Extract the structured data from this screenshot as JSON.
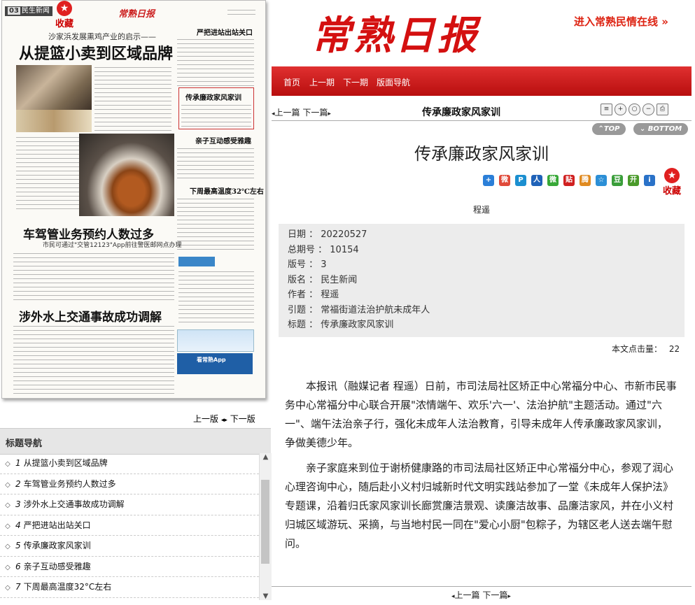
{
  "newspaper_page": {
    "section_tag_num": "03",
    "section_tag_name": "民生新闻",
    "favorite_label": "收藏",
    "paper_logo": "常熟日报",
    "kicker": "沙家浜发展熏鸡产业的启示——",
    "headline1": "从提篮小卖到区域品牌",
    "headline2": "车驾管业务预约人数过多",
    "headline2_sub": "市民可通过\"交管12123\"App前往警医邮网点办理",
    "headline3": "涉外水上交通事故成功调解",
    "col_head1": "严把进站出站关口",
    "col_head2": "传承廉政家风家训",
    "col_head3": "亲子互动感受雅趣",
    "col_head4": "下周最高温度32℃左右",
    "ad_text": "看常熟App"
  },
  "page_nav": {
    "prev": "上一版",
    "next": "下一版"
  },
  "title_nav": {
    "heading": "标题导航",
    "items": [
      {
        "num": "1",
        "label": "从提篮小卖到区域品牌"
      },
      {
        "num": "2",
        "label": "车驾管业务预约人数过多"
      },
      {
        "num": "3",
        "label": "涉外水上交通事故成功调解"
      },
      {
        "num": "4",
        "label": "严把进站出站关口"
      },
      {
        "num": "5",
        "label": "传承廉政家风家训"
      },
      {
        "num": "6",
        "label": "亲子互动感受雅趣"
      },
      {
        "num": "7",
        "label": "下周最高温度32°C左右"
      }
    ]
  },
  "masthead": {
    "logo": "常熟日报",
    "enter_link": "进入常熟民情在线"
  },
  "menu": [
    "首页",
    "上一期",
    "下一期",
    "版面导航"
  ],
  "toolbar": {
    "prev": "上一篇",
    "next": "下一篇",
    "title": "传承廉政家风家训",
    "top": "TOP",
    "bottom": "BOTTOM"
  },
  "article": {
    "title": "传承廉政家风家训",
    "author": "程遥",
    "favorite": "收藏",
    "meta": [
      {
        "k": "日期",
        "v": "20220527"
      },
      {
        "k": "总期号",
        "v": "10154"
      },
      {
        "k": "版号",
        "v": "3"
      },
      {
        "k": "版名",
        "v": "民生新闻"
      },
      {
        "k": "作者",
        "v": "程遥"
      },
      {
        "k": "引题",
        "v": "常福街道法治护航未成年人"
      },
      {
        "k": "标题",
        "v": "传承廉政家风家训"
      }
    ],
    "hits_label": "本文点击量：",
    "hits": "22",
    "para1": "本报讯（融媒记者 程遥）日前，市司法局社区矫正中心常福分中心、市新市民事务中心常福分中心联合开展\"浓情端午、欢乐'六一'、法治护航\"主题活动。通过\"六一\"、端午法治亲子行，强化未成年人法治教育，引导未成年人传承廉政家风家训，争做美德少年。",
    "para2": "亲子家庭来到位于谢桥健康路的市司法局社区矫正中心常福分中心，参观了润心心理咨询中心，随后赴小义村归城新时代文明实践站参加了一堂《未成年人保护法》专题课，沿着归氏家风家训长廊赏廉洁景观、读廉洁故事、品廉洁家风，并在小义村归城区域游玩、采摘，与当地村民一同在\"爱心小厨\"包粽子，为辖区老人送去端午慰问。"
  },
  "bottom_nav": {
    "prev": "上一篇",
    "next": "下一篇"
  },
  "colors": {
    "brand_red": "#d41010",
    "menu_bar": "#c81818"
  }
}
